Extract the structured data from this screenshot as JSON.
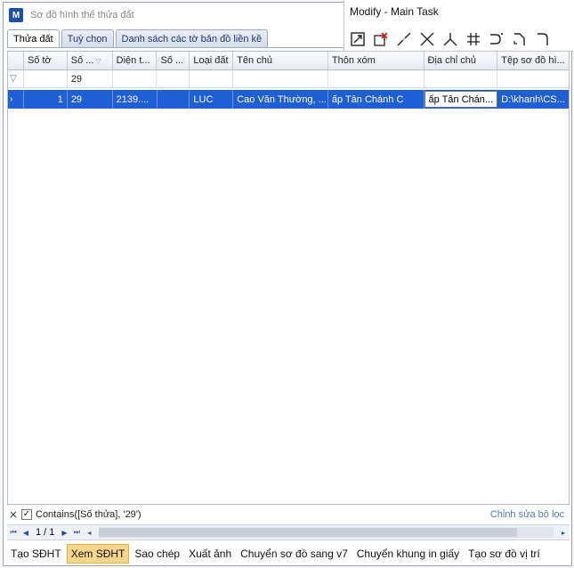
{
  "window": {
    "title": "Sơ đồ hình thể thửa đất"
  },
  "tabs": [
    {
      "label": "Thửa đất",
      "active": true
    },
    {
      "label": "Tuỳ chọn",
      "active": false
    },
    {
      "label": "Danh sách các tờ bản đồ liền kề",
      "active": false
    }
  ],
  "grid": {
    "columns": [
      "Số tờ",
      "Số ...",
      "Diện t...",
      "Số ...",
      "Loại đất",
      "Tên chủ",
      "Thôn xóm",
      "Địa chỉ chủ",
      "Tệp sơ đồ hì..."
    ],
    "filter_row": {
      "so_thua": "29"
    },
    "rows": [
      {
        "so_to": "1",
        "so_thua": "29",
        "dien_tich": "2139....",
        "so": "",
        "loai_dat": "LUC",
        "ten_chu": "Cao Văn Thường, ...",
        "thon_xom": "ấp Tân Chánh C",
        "dia_chi_chu": "ấp Tân Chán...",
        "tep_so_do": "D:\\khanh\\CS..."
      }
    ]
  },
  "filter_bar": {
    "expression": "Contains([Số thửa], '29')",
    "edit_label": "Chỉnh sửa bộ lọc"
  },
  "pager": {
    "page": "1 / 1"
  },
  "bottom_toolbar": [
    {
      "label": "Tạo SĐHT",
      "active": false
    },
    {
      "label": "Xem SĐHT",
      "active": true
    },
    {
      "label": "Sao chép",
      "active": false
    },
    {
      "label": "Xuất ảnh",
      "active": false
    },
    {
      "label": "Chuyển sơ đồ sang v7",
      "active": false
    },
    {
      "label": "Chuyển khung in giấy",
      "active": false
    },
    {
      "label": "Tạo sơ đồ vị trí",
      "active": false
    }
  ],
  "modify_toolbar": {
    "title": "Modify - Main Task",
    "tools": [
      "modify-element-icon",
      "delete-element-icon",
      "partial-delete-icon",
      "trim-icon",
      "extend-icon",
      "intersect-icon",
      "fillet-icon",
      "chamfer-icon",
      "construct-arc-icon"
    ]
  },
  "colors": {
    "selection": "#1f5fd6",
    "active_button": "#f7d58a",
    "link": "#4f78b3"
  }
}
